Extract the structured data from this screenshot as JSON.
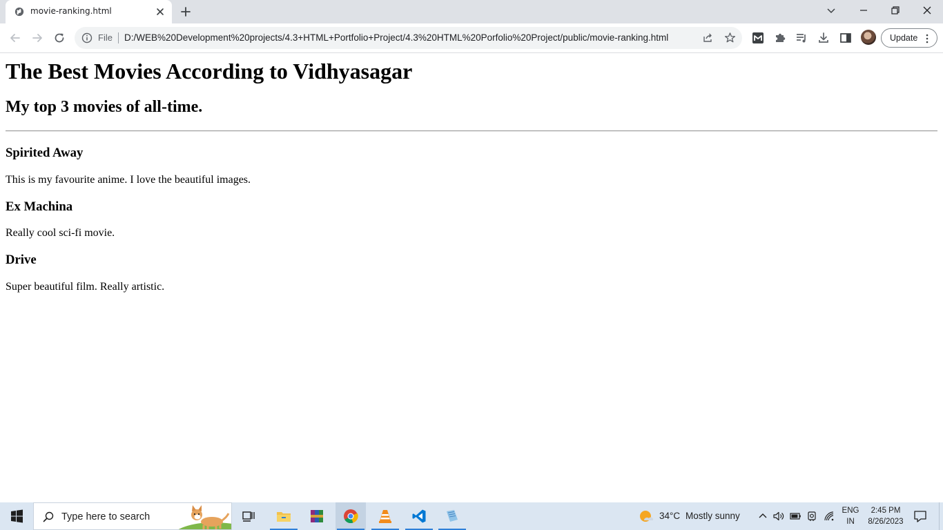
{
  "browser": {
    "tab": {
      "title": "movie-ranking.html"
    },
    "address": {
      "scheme_label": "File",
      "url": "D:/WEB%20Development%20projects/4.3+HTML+Portfolio+Project/4.3%20HTML%20Porfolio%20Project/public/movie-ranking.html"
    },
    "update_label": "Update"
  },
  "page": {
    "heading": "The Best Movies According to Vidhyasagar",
    "subheading": "My top 3 movies of all-time.",
    "movies": [
      {
        "title": "Spirited Away",
        "description": "This is my favourite anime. I love the beautiful images."
      },
      {
        "title": "Ex Machina",
        "description": "Really cool sci-fi movie."
      },
      {
        "title": "Drive",
        "description": "Super beautiful film. Really artistic."
      }
    ]
  },
  "taskbar": {
    "search_placeholder": "Type here to search",
    "apps": [
      "task-view-icon",
      "file-explorer-icon",
      "winrar-icon",
      "chrome-icon",
      "vlc-icon",
      "vscode-icon",
      "notepad-icon"
    ],
    "weather": {
      "temp": "34°C",
      "condition": "Mostly sunny"
    },
    "language": {
      "line1": "ENG",
      "line2": "IN"
    },
    "clock": {
      "time": "2:45 PM",
      "date": "8/26/2023"
    }
  },
  "colors": {
    "tabstrip": "#dee1e6",
    "taskbar": "#dbe6f2",
    "accent": "#1a73e8"
  }
}
